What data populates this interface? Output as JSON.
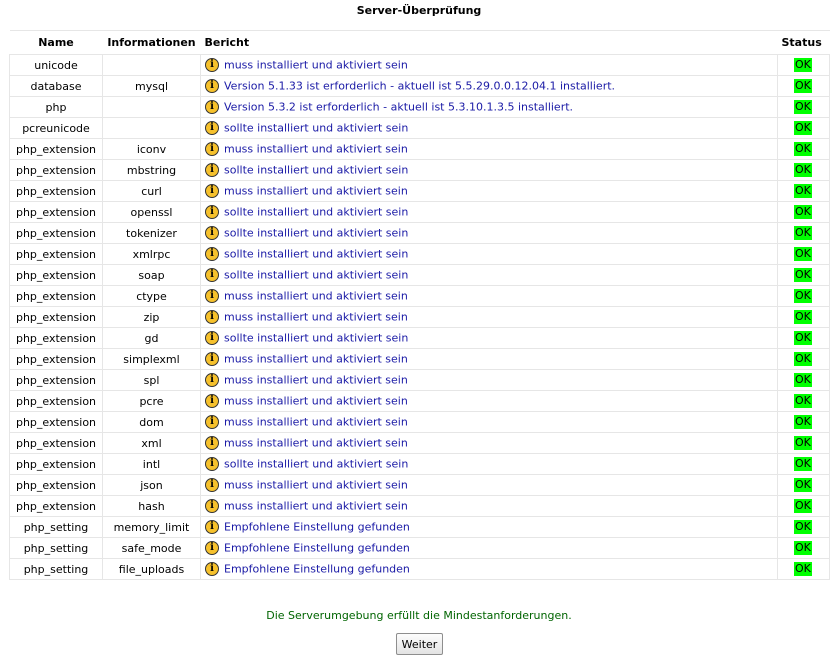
{
  "page": {
    "title": "Server-Überprüfung",
    "footer_message": "Die Serverumgebung erfüllt die Mindestanforderungen.",
    "continue_label": "Weiter"
  },
  "table": {
    "headers": {
      "name": "Name",
      "info": "Informationen",
      "report": "Bericht",
      "status": "Status"
    },
    "rows": [
      {
        "name": "unicode",
        "info": "",
        "report": "muss installiert und aktiviert sein",
        "status": "OK"
      },
      {
        "name": "database",
        "info": "mysql",
        "report": "Version 5.1.33 ist erforderlich - aktuell ist 5.5.29.0.0.12.04.1 installiert.",
        "status": "OK"
      },
      {
        "name": "php",
        "info": "",
        "report": "Version 5.3.2 ist erforderlich - aktuell ist 5.3.10.1.3.5 installiert.",
        "status": "OK"
      },
      {
        "name": "pcreunicode",
        "info": "",
        "report": "sollte installiert und aktiviert sein",
        "status": "OK"
      },
      {
        "name": "php_extension",
        "info": "iconv",
        "report": "muss installiert und aktiviert sein",
        "status": "OK"
      },
      {
        "name": "php_extension",
        "info": "mbstring",
        "report": "sollte installiert und aktiviert sein",
        "status": "OK"
      },
      {
        "name": "php_extension",
        "info": "curl",
        "report": "muss installiert und aktiviert sein",
        "status": "OK"
      },
      {
        "name": "php_extension",
        "info": "openssl",
        "report": "sollte installiert und aktiviert sein",
        "status": "OK"
      },
      {
        "name": "php_extension",
        "info": "tokenizer",
        "report": "sollte installiert und aktiviert sein",
        "status": "OK"
      },
      {
        "name": "php_extension",
        "info": "xmlrpc",
        "report": "sollte installiert und aktiviert sein",
        "status": "OK"
      },
      {
        "name": "php_extension",
        "info": "soap",
        "report": "sollte installiert und aktiviert sein",
        "status": "OK"
      },
      {
        "name": "php_extension",
        "info": "ctype",
        "report": "muss installiert und aktiviert sein",
        "status": "OK"
      },
      {
        "name": "php_extension",
        "info": "zip",
        "report": "muss installiert und aktiviert sein",
        "status": "OK"
      },
      {
        "name": "php_extension",
        "info": "gd",
        "report": "sollte installiert und aktiviert sein",
        "status": "OK"
      },
      {
        "name": "php_extension",
        "info": "simplexml",
        "report": "muss installiert und aktiviert sein",
        "status": "OK"
      },
      {
        "name": "php_extension",
        "info": "spl",
        "report": "muss installiert und aktiviert sein",
        "status": "OK"
      },
      {
        "name": "php_extension",
        "info": "pcre",
        "report": "muss installiert und aktiviert sein",
        "status": "OK"
      },
      {
        "name": "php_extension",
        "info": "dom",
        "report": "muss installiert und aktiviert sein",
        "status": "OK"
      },
      {
        "name": "php_extension",
        "info": "xml",
        "report": "muss installiert und aktiviert sein",
        "status": "OK"
      },
      {
        "name": "php_extension",
        "info": "intl",
        "report": "sollte installiert und aktiviert sein",
        "status": "OK"
      },
      {
        "name": "php_extension",
        "info": "json",
        "report": "muss installiert und aktiviert sein",
        "status": "OK"
      },
      {
        "name": "php_extension",
        "info": "hash",
        "report": "muss installiert und aktiviert sein",
        "status": "OK"
      },
      {
        "name": "php_setting",
        "info": "memory_limit",
        "report": "Empfohlene Einstellung gefunden",
        "status": "OK"
      },
      {
        "name": "php_setting",
        "info": "safe_mode",
        "report": "Empfohlene Einstellung gefunden",
        "status": "OK"
      },
      {
        "name": "php_setting",
        "info": "file_uploads",
        "report": "Empfohlene Einstellung gefunden",
        "status": "OK"
      }
    ]
  },
  "icons": {
    "report_icon": "info-warning-icon"
  },
  "colors": {
    "ok_background": "#00ff00",
    "report_text": "#1a1aa6",
    "footer_text": "#006400",
    "warning_icon": "#f6c12c"
  }
}
